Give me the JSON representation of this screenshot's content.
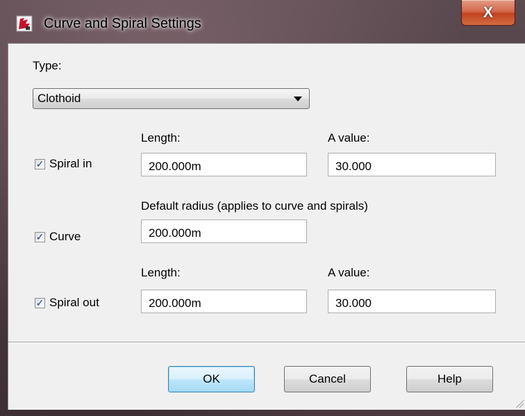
{
  "window": {
    "title": "Curve and Spiral Settings",
    "close_glyph": "X"
  },
  "type_section": {
    "label": "Type:",
    "selected": "Clothoid"
  },
  "spiral_in": {
    "checkbox_label": "Spiral in",
    "checked": true,
    "length_label": "Length:",
    "length_value": "200.000m",
    "a_label": "A value:",
    "a_value": "30.000"
  },
  "curve": {
    "checkbox_label": "Curve",
    "checked": true,
    "radius_label": "Default radius (applies to curve and spirals)",
    "radius_value": "200.000m"
  },
  "spiral_out": {
    "checkbox_label": "Spiral out",
    "checked": true,
    "length_label": "Length:",
    "length_value": "200.000m",
    "a_label": "A value:",
    "a_value": "30.000"
  },
  "buttons": {
    "ok": "OK",
    "cancel": "Cancel",
    "help": "Help"
  },
  "icons": {
    "app": "app-icon",
    "close": "close-icon",
    "dropdown": "chevron-down-icon",
    "check": "check-icon",
    "grip": "resize-grip-icon"
  },
  "colors": {
    "close_button": "#c2431f",
    "default_button_border": "#3c7fb1",
    "dialog_bg": "#f0f0f0"
  }
}
